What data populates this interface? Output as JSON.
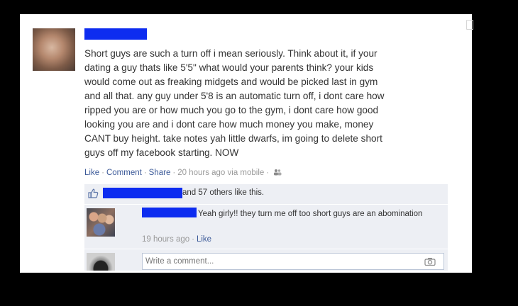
{
  "post": {
    "text": "Short guys are such a turn off i mean seriously. Think about it, if your\ndating a guy thats like 5'5\" what would your parents think? your kids\nwould come out as freaking midgets and would be picked last in gym\nand all that. any guy under 5'8 is an automatic turn off, i dont care how\nripped you are or how much you go to the gym, i dont care how good\nlooking you are and i dont care how much money you make, money\nCANT buy height. take notes yah little dwarfs, im going to delete short\nguys off my facebook starting. NOW",
    "actions": {
      "like": "Like",
      "comment": "Comment",
      "share": "Share",
      "time": "20 hours ago via mobile"
    }
  },
  "likes": {
    "text": "and 57 others like this."
  },
  "comment": {
    "text": "Yeah girly!! they turn me off too short guys are an abomination",
    "time": "19 hours ago",
    "like": "Like"
  },
  "reply": {
    "placeholder": "Write a comment..."
  },
  "icons": {
    "avatar": "profile-photo",
    "audience": "friends-icon",
    "like": "thumbs-up-icon",
    "camera": "camera-icon"
  },
  "colors": {
    "link": "#3b5998",
    "redaction": "#0d2cf0",
    "comment_bg": "#edeff4",
    "text": "#333333",
    "meta": "#999999"
  }
}
